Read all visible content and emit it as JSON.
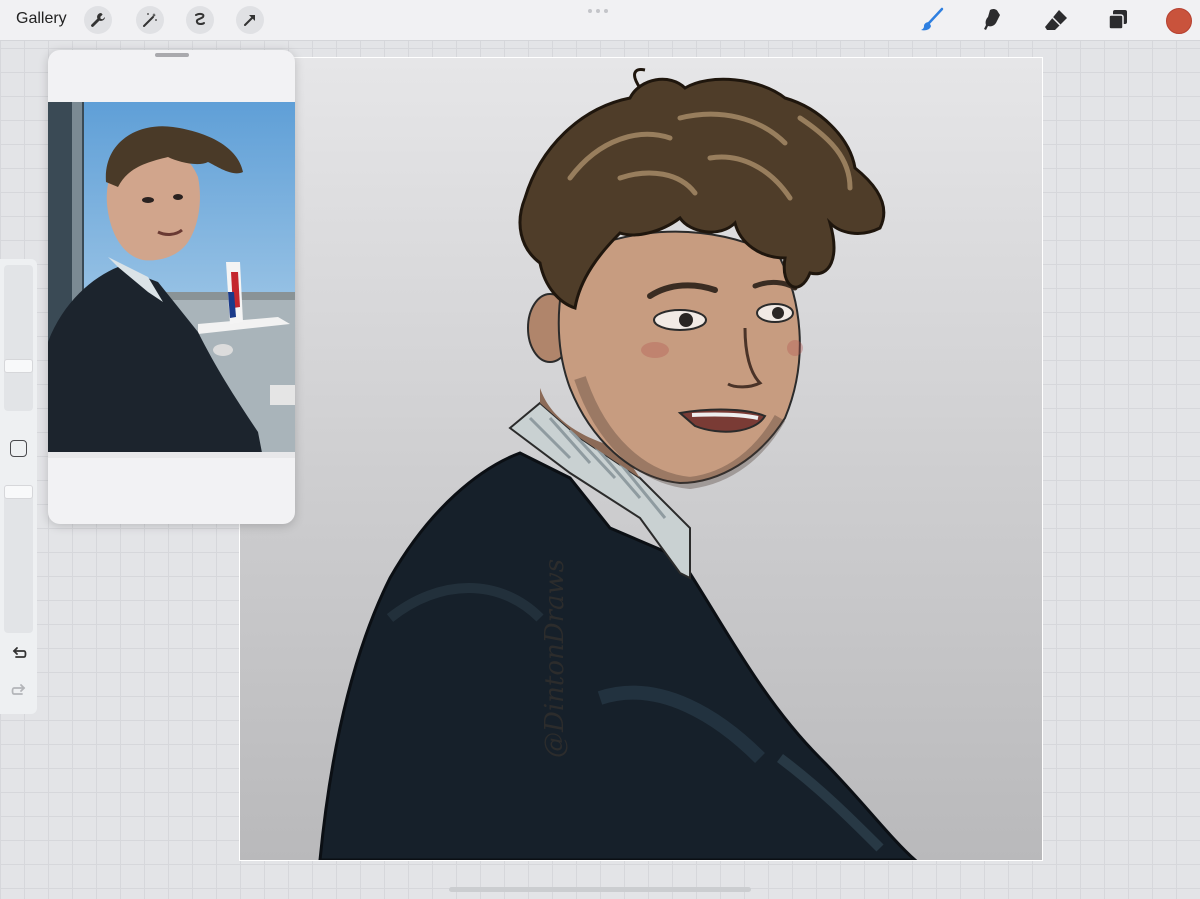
{
  "toolbar": {
    "gallery_label": "Gallery",
    "left_tools": [
      "wrench-icon",
      "magic-wand-icon",
      "selection-icon",
      "transform-arrow-icon"
    ],
    "right_tools": [
      "brush-icon",
      "smudge-icon",
      "eraser-icon",
      "layers-icon"
    ],
    "active_tool": "brush-icon",
    "current_color": "#c9533c",
    "accent_color": "#2e7fe0"
  },
  "reference_window": {
    "content": "reference photo"
  },
  "canvas": {
    "signature": "@DintonDraws"
  },
  "sidebar": {
    "brush_size_icon": "slider",
    "opacity_icon": "slider",
    "modify_icon": "square-icon",
    "undo_icon": "undo-icon",
    "redo_icon": "redo-icon"
  }
}
